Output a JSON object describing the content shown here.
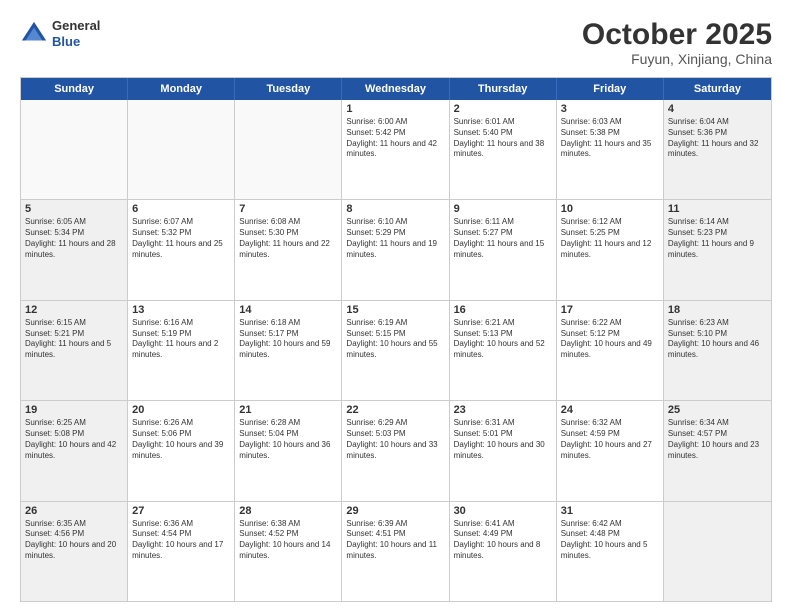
{
  "header": {
    "logo": {
      "general": "General",
      "blue": "Blue"
    },
    "title": "October 2025",
    "subtitle": "Fuyun, Xinjiang, China"
  },
  "days": [
    "Sunday",
    "Monday",
    "Tuesday",
    "Wednesday",
    "Thursday",
    "Friday",
    "Saturday"
  ],
  "rows": [
    [
      {
        "day": "",
        "sunrise": "",
        "sunset": "",
        "daylight": "",
        "empty": true
      },
      {
        "day": "",
        "sunrise": "",
        "sunset": "",
        "daylight": "",
        "empty": true
      },
      {
        "day": "",
        "sunrise": "",
        "sunset": "",
        "daylight": "",
        "empty": true
      },
      {
        "day": "1",
        "sunrise": "Sunrise: 6:00 AM",
        "sunset": "Sunset: 5:42 PM",
        "daylight": "Daylight: 11 hours and 42 minutes.",
        "empty": false
      },
      {
        "day": "2",
        "sunrise": "Sunrise: 6:01 AM",
        "sunset": "Sunset: 5:40 PM",
        "daylight": "Daylight: 11 hours and 38 minutes.",
        "empty": false
      },
      {
        "day": "3",
        "sunrise": "Sunrise: 6:03 AM",
        "sunset": "Sunset: 5:38 PM",
        "daylight": "Daylight: 11 hours and 35 minutes.",
        "empty": false
      },
      {
        "day": "4",
        "sunrise": "Sunrise: 6:04 AM",
        "sunset": "Sunset: 5:36 PM",
        "daylight": "Daylight: 11 hours and 32 minutes.",
        "empty": false,
        "shaded": true
      }
    ],
    [
      {
        "day": "5",
        "sunrise": "Sunrise: 6:05 AM",
        "sunset": "Sunset: 5:34 PM",
        "daylight": "Daylight: 11 hours and 28 minutes.",
        "empty": false,
        "shaded": true
      },
      {
        "day": "6",
        "sunrise": "Sunrise: 6:07 AM",
        "sunset": "Sunset: 5:32 PM",
        "daylight": "Daylight: 11 hours and 25 minutes.",
        "empty": false
      },
      {
        "day": "7",
        "sunrise": "Sunrise: 6:08 AM",
        "sunset": "Sunset: 5:30 PM",
        "daylight": "Daylight: 11 hours and 22 minutes.",
        "empty": false
      },
      {
        "day": "8",
        "sunrise": "Sunrise: 6:10 AM",
        "sunset": "Sunset: 5:29 PM",
        "daylight": "Daylight: 11 hours and 19 minutes.",
        "empty": false
      },
      {
        "day": "9",
        "sunrise": "Sunrise: 6:11 AM",
        "sunset": "Sunset: 5:27 PM",
        "daylight": "Daylight: 11 hours and 15 minutes.",
        "empty": false
      },
      {
        "day": "10",
        "sunrise": "Sunrise: 6:12 AM",
        "sunset": "Sunset: 5:25 PM",
        "daylight": "Daylight: 11 hours and 12 minutes.",
        "empty": false
      },
      {
        "day": "11",
        "sunrise": "Sunrise: 6:14 AM",
        "sunset": "Sunset: 5:23 PM",
        "daylight": "Daylight: 11 hours and 9 minutes.",
        "empty": false,
        "shaded": true
      }
    ],
    [
      {
        "day": "12",
        "sunrise": "Sunrise: 6:15 AM",
        "sunset": "Sunset: 5:21 PM",
        "daylight": "Daylight: 11 hours and 5 minutes.",
        "empty": false,
        "shaded": true
      },
      {
        "day": "13",
        "sunrise": "Sunrise: 6:16 AM",
        "sunset": "Sunset: 5:19 PM",
        "daylight": "Daylight: 11 hours and 2 minutes.",
        "empty": false
      },
      {
        "day": "14",
        "sunrise": "Sunrise: 6:18 AM",
        "sunset": "Sunset: 5:17 PM",
        "daylight": "Daylight: 10 hours and 59 minutes.",
        "empty": false
      },
      {
        "day": "15",
        "sunrise": "Sunrise: 6:19 AM",
        "sunset": "Sunset: 5:15 PM",
        "daylight": "Daylight: 10 hours and 55 minutes.",
        "empty": false
      },
      {
        "day": "16",
        "sunrise": "Sunrise: 6:21 AM",
        "sunset": "Sunset: 5:13 PM",
        "daylight": "Daylight: 10 hours and 52 minutes.",
        "empty": false
      },
      {
        "day": "17",
        "sunrise": "Sunrise: 6:22 AM",
        "sunset": "Sunset: 5:12 PM",
        "daylight": "Daylight: 10 hours and 49 minutes.",
        "empty": false
      },
      {
        "day": "18",
        "sunrise": "Sunrise: 6:23 AM",
        "sunset": "Sunset: 5:10 PM",
        "daylight": "Daylight: 10 hours and 46 minutes.",
        "empty": false,
        "shaded": true
      }
    ],
    [
      {
        "day": "19",
        "sunrise": "Sunrise: 6:25 AM",
        "sunset": "Sunset: 5:08 PM",
        "daylight": "Daylight: 10 hours and 42 minutes.",
        "empty": false,
        "shaded": true
      },
      {
        "day": "20",
        "sunrise": "Sunrise: 6:26 AM",
        "sunset": "Sunset: 5:06 PM",
        "daylight": "Daylight: 10 hours and 39 minutes.",
        "empty": false
      },
      {
        "day": "21",
        "sunrise": "Sunrise: 6:28 AM",
        "sunset": "Sunset: 5:04 PM",
        "daylight": "Daylight: 10 hours and 36 minutes.",
        "empty": false
      },
      {
        "day": "22",
        "sunrise": "Sunrise: 6:29 AM",
        "sunset": "Sunset: 5:03 PM",
        "daylight": "Daylight: 10 hours and 33 minutes.",
        "empty": false
      },
      {
        "day": "23",
        "sunrise": "Sunrise: 6:31 AM",
        "sunset": "Sunset: 5:01 PM",
        "daylight": "Daylight: 10 hours and 30 minutes.",
        "empty": false
      },
      {
        "day": "24",
        "sunrise": "Sunrise: 6:32 AM",
        "sunset": "Sunset: 4:59 PM",
        "daylight": "Daylight: 10 hours and 27 minutes.",
        "empty": false
      },
      {
        "day": "25",
        "sunrise": "Sunrise: 6:34 AM",
        "sunset": "Sunset: 4:57 PM",
        "daylight": "Daylight: 10 hours and 23 minutes.",
        "empty": false,
        "shaded": true
      }
    ],
    [
      {
        "day": "26",
        "sunrise": "Sunrise: 6:35 AM",
        "sunset": "Sunset: 4:56 PM",
        "daylight": "Daylight: 10 hours and 20 minutes.",
        "empty": false,
        "shaded": true
      },
      {
        "day": "27",
        "sunrise": "Sunrise: 6:36 AM",
        "sunset": "Sunset: 4:54 PM",
        "daylight": "Daylight: 10 hours and 17 minutes.",
        "empty": false
      },
      {
        "day": "28",
        "sunrise": "Sunrise: 6:38 AM",
        "sunset": "Sunset: 4:52 PM",
        "daylight": "Daylight: 10 hours and 14 minutes.",
        "empty": false
      },
      {
        "day": "29",
        "sunrise": "Sunrise: 6:39 AM",
        "sunset": "Sunset: 4:51 PM",
        "daylight": "Daylight: 10 hours and 11 minutes.",
        "empty": false
      },
      {
        "day": "30",
        "sunrise": "Sunrise: 6:41 AM",
        "sunset": "Sunset: 4:49 PM",
        "daylight": "Daylight: 10 hours and 8 minutes.",
        "empty": false
      },
      {
        "day": "31",
        "sunrise": "Sunrise: 6:42 AM",
        "sunset": "Sunset: 4:48 PM",
        "daylight": "Daylight: 10 hours and 5 minutes.",
        "empty": false
      },
      {
        "day": "",
        "sunrise": "",
        "sunset": "",
        "daylight": "",
        "empty": true,
        "shaded": true
      }
    ]
  ]
}
